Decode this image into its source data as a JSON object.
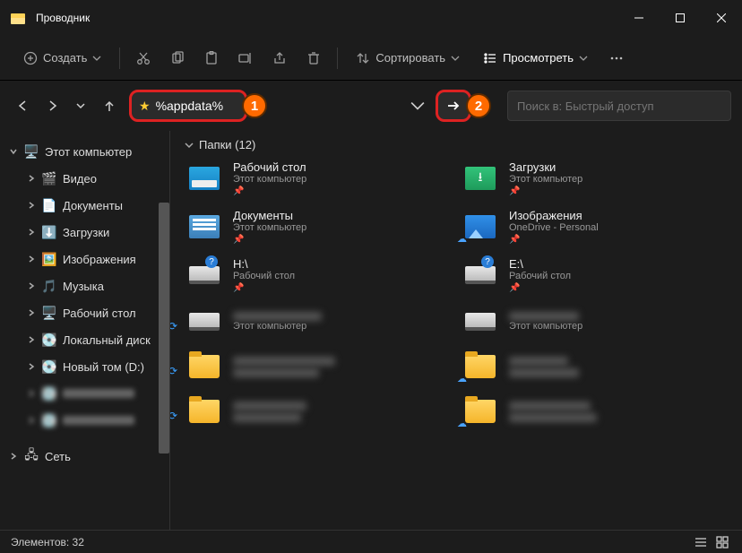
{
  "title": "Проводник",
  "toolbar": {
    "create": "Создать",
    "sort": "Сортировать",
    "view": "Просмотреть"
  },
  "address": {
    "value": "%appdata%"
  },
  "search": {
    "placeholder": "Поиск в: Быстрый доступ"
  },
  "callouts": {
    "one": "1",
    "two": "2"
  },
  "sidebar": {
    "root": "Этот компьютер",
    "items": [
      "Видео",
      "Документы",
      "Загрузки",
      "Изображения",
      "Музыка",
      "Рабочий стол",
      "Локальный диск",
      "Новый том (D:)"
    ],
    "network": "Сеть"
  },
  "section": {
    "head": "Папки (12)"
  },
  "folders": [
    {
      "name": "Рабочий стол",
      "sub": "Этот компьютер",
      "icon": "desktop",
      "pin": true
    },
    {
      "name": "Загрузки",
      "sub": "Этот компьютер",
      "icon": "dl",
      "pin": true
    },
    {
      "name": "Документы",
      "sub": "Этот компьютер",
      "icon": "doc",
      "pin": true
    },
    {
      "name": "Изображения",
      "sub": "OneDrive - Personal",
      "icon": "img",
      "pin": true,
      "cloud": true
    },
    {
      "name": "H:\\",
      "sub": "Рабочий стол",
      "icon": "drive-q",
      "pin": true
    },
    {
      "name": "E:\\",
      "sub": "Рабочий стол",
      "icon": "drive-q",
      "pin": true
    },
    {
      "name": "",
      "sub": "Этот компьютер",
      "icon": "drive",
      "blur": true,
      "sync": true
    },
    {
      "name": "",
      "sub": "Этот компьютер",
      "icon": "drive",
      "blur": true
    },
    {
      "name": "",
      "sub": "",
      "icon": "folder",
      "blur": true,
      "sync": true
    },
    {
      "name": "",
      "sub": "",
      "icon": "folder",
      "blur": true,
      "cloud": true
    },
    {
      "name": "",
      "sub": "",
      "icon": "folder",
      "blur": true,
      "sync": true
    },
    {
      "name": "",
      "sub": "",
      "icon": "folder",
      "blur": true,
      "cloud": true
    }
  ],
  "status": {
    "count": "Элементов: 32"
  }
}
